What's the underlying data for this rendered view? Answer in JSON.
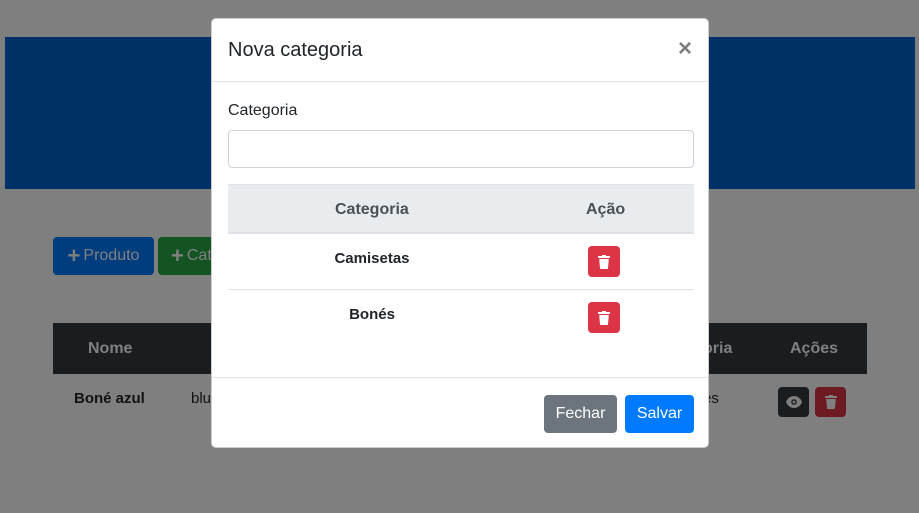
{
  "page": {
    "buttons": {
      "produto": "Produto",
      "categoria": "Cat"
    },
    "table": {
      "headers": {
        "nome": "Nome",
        "categoria": "oria",
        "acoes": "Ações"
      },
      "rows": [
        {
          "nome": "Boné azul",
          "descricao": "blu",
          "categoria": "és"
        }
      ]
    }
  },
  "modal": {
    "title": "Nova categoria",
    "close": "×",
    "field_label": "Categoria",
    "field_value": "",
    "table": {
      "headers": {
        "categoria": "Categoria",
        "acao": "Ação"
      },
      "rows": [
        {
          "categoria": "Camisetas"
        },
        {
          "categoria": "Bonés"
        }
      ]
    },
    "footer": {
      "close_label": "Fechar",
      "save_label": "Salvar"
    }
  },
  "colors": {
    "primary": "#007bff",
    "success": "#28a745",
    "danger": "#dc3545",
    "secondary": "#6c757d",
    "dark": "#343a40",
    "hero": "#0062cc"
  }
}
